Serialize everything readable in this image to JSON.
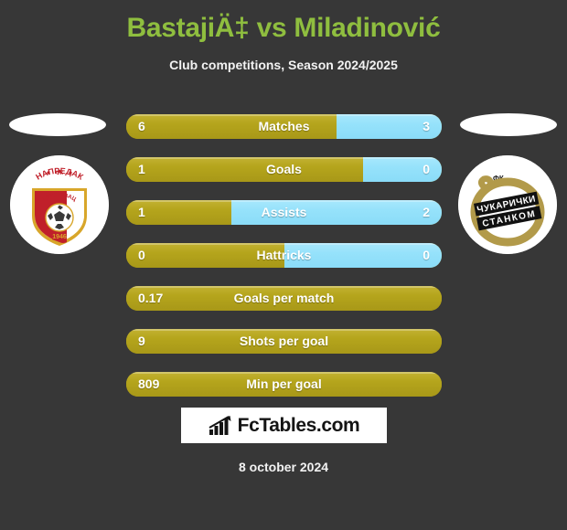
{
  "header": {
    "title": "BastajiÄ‡ vs Miladinović",
    "subtitle": "Club competitions, Season 2024/2025"
  },
  "badges": {
    "home": {
      "name": "fk-napredak-krusevac",
      "text_top": "ФК",
      "text_main": "НАПРЕДАК",
      "text_city": "КРУШЕВАЦ",
      "year": "1946",
      "colors": {
        "red": "#c0202a",
        "gold": "#d8a62a",
        "white": "#ffffff"
      }
    },
    "away": {
      "name": "fk-cukaricki-stankom",
      "text_top": "ФК",
      "text_main": "ЧУКАРИЧКИ",
      "text_sub": "СТАНКОМ",
      "colors": {
        "gold": "#b29a4a",
        "black": "#111111",
        "white": "#ffffff"
      }
    }
  },
  "colors": {
    "background": "#373737",
    "title": "#8fbe3f",
    "home_bar": "#b5a51c",
    "away_bar": "#96e2fb",
    "text": "#ffffff"
  },
  "chart_data": {
    "type": "bar",
    "title": "BastajiÄ‡ vs Miladinović",
    "subtitle": "Club competitions, Season 2024/2025",
    "orientation": "horizontal-diverging",
    "series": [
      {
        "name": "BastajiÄ‡",
        "color": "#b5a51c"
      },
      {
        "name": "Miladinović",
        "color": "#96e2fb"
      }
    ],
    "categories": [
      "Matches",
      "Goals",
      "Assists",
      "Hattricks",
      "Goals per match",
      "Shots per goal",
      "Min per goal"
    ],
    "rows": [
      {
        "label": "Matches",
        "home": "6",
        "away": "3",
        "home_pct": 66.7,
        "single": false
      },
      {
        "label": "Goals",
        "home": "1",
        "away": "0",
        "home_pct": 75.0,
        "single": false
      },
      {
        "label": "Assists",
        "home": "1",
        "away": "2",
        "home_pct": 33.3,
        "single": false
      },
      {
        "label": "Hattricks",
        "home": "0",
        "away": "0",
        "home_pct": 50.0,
        "single": false
      },
      {
        "label": "Goals per match",
        "home": "0.17",
        "away": "",
        "home_pct": 100,
        "single": true
      },
      {
        "label": "Shots per goal",
        "home": "9",
        "away": "",
        "home_pct": 100,
        "single": true
      },
      {
        "label": "Min per goal",
        "home": "809",
        "away": "",
        "home_pct": 100,
        "single": true
      }
    ]
  },
  "footer": {
    "logo_text": "FcTables.com",
    "logo_icon": "bar-chart-arrow-icon",
    "date": "8 october 2024"
  }
}
